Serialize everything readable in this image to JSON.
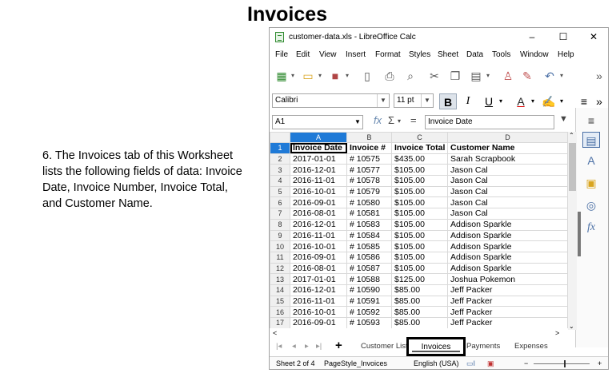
{
  "slide": {
    "title": "Invoices",
    "body": "6. The Invoices tab of this Worksheet lists the following fields of data:  Invoice Date, Invoice Number, Invoice Total, and Customer Name."
  },
  "window": {
    "title": "customer-data.xls - LibreOffice Calc",
    "minimize": "–",
    "maximize": "☐",
    "close": "✕"
  },
  "menu": [
    "File",
    "Edit",
    "View",
    "Insert",
    "Format",
    "Styles",
    "Sheet",
    "Data",
    "Tools",
    "Window",
    "Help"
  ],
  "format_bar": {
    "font_name": "Calibri",
    "font_size": "11 pt",
    "bold": "B",
    "italic": "I",
    "underline": "U"
  },
  "formula_bar": {
    "cell_ref": "A1",
    "content": "Invoice Date"
  },
  "sheet": {
    "columns": [
      "A",
      "B",
      "C",
      "D"
    ],
    "rows": [
      {
        "n": "1",
        "cells": [
          "Invoice Date",
          "Invoice #",
          "Invoice Total",
          "Customer Name"
        ]
      },
      {
        "n": "2",
        "cells": [
          "2017-01-01",
          "# 10575",
          "$435.00",
          "Sarah Scrapbook"
        ]
      },
      {
        "n": "3",
        "cells": [
          "2016-12-01",
          "# 10577",
          "$105.00",
          "Jason Cal"
        ]
      },
      {
        "n": "4",
        "cells": [
          "2016-11-01",
          "# 10578",
          "$105.00",
          "Jason Cal"
        ]
      },
      {
        "n": "5",
        "cells": [
          "2016-10-01",
          "# 10579",
          "$105.00",
          "Jason Cal"
        ]
      },
      {
        "n": "6",
        "cells": [
          "2016-09-01",
          "# 10580",
          "$105.00",
          "Jason Cal"
        ]
      },
      {
        "n": "7",
        "cells": [
          "2016-08-01",
          "# 10581",
          "$105.00",
          "Jason Cal"
        ]
      },
      {
        "n": "8",
        "cells": [
          "2016-12-01",
          "# 10583",
          "$105.00",
          "Addison Sparkle"
        ]
      },
      {
        "n": "9",
        "cells": [
          "2016-11-01",
          "# 10584",
          "$105.00",
          "Addison Sparkle"
        ]
      },
      {
        "n": "10",
        "cells": [
          "2016-10-01",
          "# 10585",
          "$105.00",
          "Addison Sparkle"
        ]
      },
      {
        "n": "11",
        "cells": [
          "2016-09-01",
          "# 10586",
          "$105.00",
          "Addison Sparkle"
        ]
      },
      {
        "n": "12",
        "cells": [
          "2016-08-01",
          "# 10587",
          "$105.00",
          "Addison Sparkle"
        ]
      },
      {
        "n": "13",
        "cells": [
          "2017-01-01",
          "# 10588",
          "$125.00",
          "Joshua Pokemon"
        ]
      },
      {
        "n": "14",
        "cells": [
          "2016-12-01",
          "# 10590",
          "$85.00",
          "Jeff Packer"
        ]
      },
      {
        "n": "15",
        "cells": [
          "2016-11-01",
          "# 10591",
          "$85.00",
          "Jeff Packer"
        ]
      },
      {
        "n": "16",
        "cells": [
          "2016-10-01",
          "# 10592",
          "$85.00",
          "Jeff Packer"
        ]
      },
      {
        "n": "17",
        "cells": [
          "2016-09-01",
          "# 10593",
          "$85.00",
          "Jeff Packer"
        ]
      }
    ]
  },
  "tabs": {
    "customer": "Customer List",
    "invoices": "Invoices",
    "payments": "Payments",
    "expenses": "Expenses"
  },
  "status": {
    "sheet": "Sheet 2 of 4",
    "page_style": "PageStyle_Invoices",
    "language": "English (USA)"
  },
  "colors": {
    "selection": "#1f7ad7",
    "sidebar_icon": "#4a6fa5"
  }
}
